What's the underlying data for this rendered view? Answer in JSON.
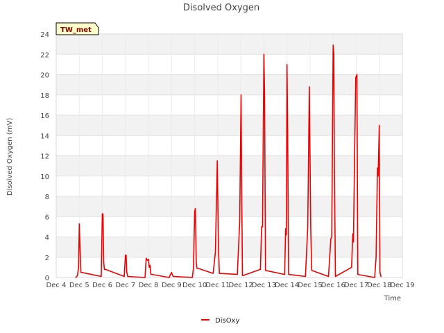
{
  "chart_data": {
    "type": "line",
    "title": "Disolved Oxygen",
    "xlabel": "Time",
    "ylabel": "Disolved Oxygen (mV)",
    "site_label": "TW_met",
    "xlim": [
      4,
      19
    ],
    "ylim": [
      0,
      24
    ],
    "x_ticks": [
      {
        "value": 4,
        "label": "Dec 4"
      },
      {
        "value": 5,
        "label": "Dec 5"
      },
      {
        "value": 6,
        "label": "Dec 6"
      },
      {
        "value": 7,
        "label": "Dec 7"
      },
      {
        "value": 8,
        "label": "Dec 8"
      },
      {
        "value": 9,
        "label": "Dec 9"
      },
      {
        "value": 10,
        "label": "Dec 10"
      },
      {
        "value": 11,
        "label": "Dec 11"
      },
      {
        "value": 12,
        "label": "Dec 12"
      },
      {
        "value": 13,
        "label": "Dec 13"
      },
      {
        "value": 14,
        "label": "Dec 14"
      },
      {
        "value": 15,
        "label": "Dec 15"
      },
      {
        "value": 16,
        "label": "Dec 16"
      },
      {
        "value": 17,
        "label": "Dec 17"
      },
      {
        "value": 18,
        "label": "Dec 18"
      },
      {
        "value": 19,
        "label": "Dec 19"
      }
    ],
    "y_ticks": [
      0,
      2,
      4,
      6,
      8,
      10,
      12,
      14,
      16,
      18,
      20,
      22,
      24
    ],
    "grid": "horizontal bands",
    "legend_position": "bottom-center",
    "series": [
      {
        "name": "DisOxy",
        "color": "#ee0000",
        "x": [
          4.85,
          4.92,
          4.97,
          5.0,
          5.04,
          5.07,
          5.1,
          5.95,
          6.0,
          6.03,
          6.06,
          6.09,
          6.13,
          6.95,
          7.0,
          7.03,
          7.06,
          7.1,
          7.85,
          7.9,
          7.95,
          8.0,
          8.03,
          8.07,
          8.1,
          8.13,
          8.16,
          8.9,
          8.95,
          9.0,
          9.03,
          9.07,
          9.1,
          9.9,
          9.95,
          10.0,
          10.03,
          10.07,
          10.1,
          10.14,
          10.8,
          10.9,
          10.98,
          11.03,
          11.07,
          11.1,
          11.85,
          11.95,
          12.01,
          12.04,
          12.07,
          12.1,
          12.85,
          12.9,
          12.94,
          13.0,
          13.03,
          13.07,
          13.9,
          13.94,
          13.97,
          14.0,
          14.03,
          14.07,
          14.8,
          14.9,
          14.97,
          15.03,
          15.07,
          15.8,
          15.9,
          15.94,
          16.0,
          16.03,
          16.05,
          16.1,
          16.8,
          16.85,
          16.88,
          16.93,
          16.98,
          17.03,
          17.07,
          17.8,
          17.86,
          17.92,
          17.95,
          18.0,
          18.03,
          18.07
        ],
        "y": [
          0.0,
          0.2,
          1.0,
          5.3,
          2.5,
          0.5,
          0.5,
          0.1,
          6.3,
          6.2,
          1.5,
          0.8,
          0.8,
          0.1,
          2.2,
          2.2,
          0.5,
          0.1,
          0.0,
          1.9,
          1.7,
          1.8,
          1.0,
          1.2,
          0.3,
          0.3,
          0.3,
          0.0,
          0.3,
          0.5,
          0.3,
          0.1,
          0.1,
          0.0,
          1.0,
          6.5,
          6.8,
          1.5,
          0.9,
          0.9,
          0.4,
          2.5,
          11.5,
          3.0,
          0.4,
          0.4,
          0.3,
          5.5,
          18.0,
          8.0,
          0.2,
          0.2,
          0.8,
          5.0,
          5.0,
          22.0,
          18.0,
          0.7,
          0.3,
          4.8,
          4.2,
          21.0,
          14.0,
          0.3,
          0.1,
          5.0,
          18.8,
          5.0,
          0.7,
          0.1,
          3.8,
          4.0,
          22.9,
          22.0,
          12.0,
          0.1,
          1.0,
          4.3,
          3.5,
          12.0,
          19.7,
          20.0,
          0.3,
          0.0,
          2.0,
          10.8,
          10.0,
          15.0,
          0.5,
          0.1
        ]
      }
    ]
  }
}
